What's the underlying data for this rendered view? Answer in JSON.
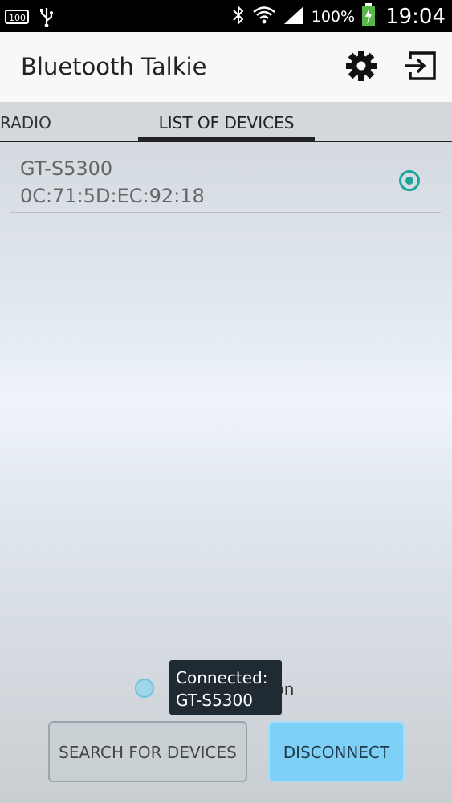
{
  "status_bar": {
    "battery_percent": "100%",
    "time": "19:04",
    "icons": [
      "sd-card-icon",
      "usb-icon",
      "bluetooth-icon",
      "wifi-icon",
      "signal-icon",
      "battery-charging-icon"
    ]
  },
  "app_bar": {
    "title": "Bluetooth Talkie",
    "icons": [
      "settings-gear-icon",
      "exit-icon"
    ]
  },
  "tabs": [
    {
      "label": "RADIO",
      "active": false
    },
    {
      "label": "LIST OF DEVICES",
      "active": true
    }
  ],
  "devices": [
    {
      "name": "GT-S5300",
      "mac": "0C:71:5D:EC:92:18",
      "selected": true
    }
  ],
  "bottom": {
    "option_label_visible": "ion",
    "toast_line1": "Connected:",
    "toast_line2": "GT-S5300",
    "search_button": "SEARCH FOR DEVICES",
    "disconnect_button": "DISCONNECT"
  },
  "colors": {
    "accent": "#1aa69a",
    "disconnect_button": "#7fd0f7",
    "toast_bg": "#1f2a33"
  }
}
